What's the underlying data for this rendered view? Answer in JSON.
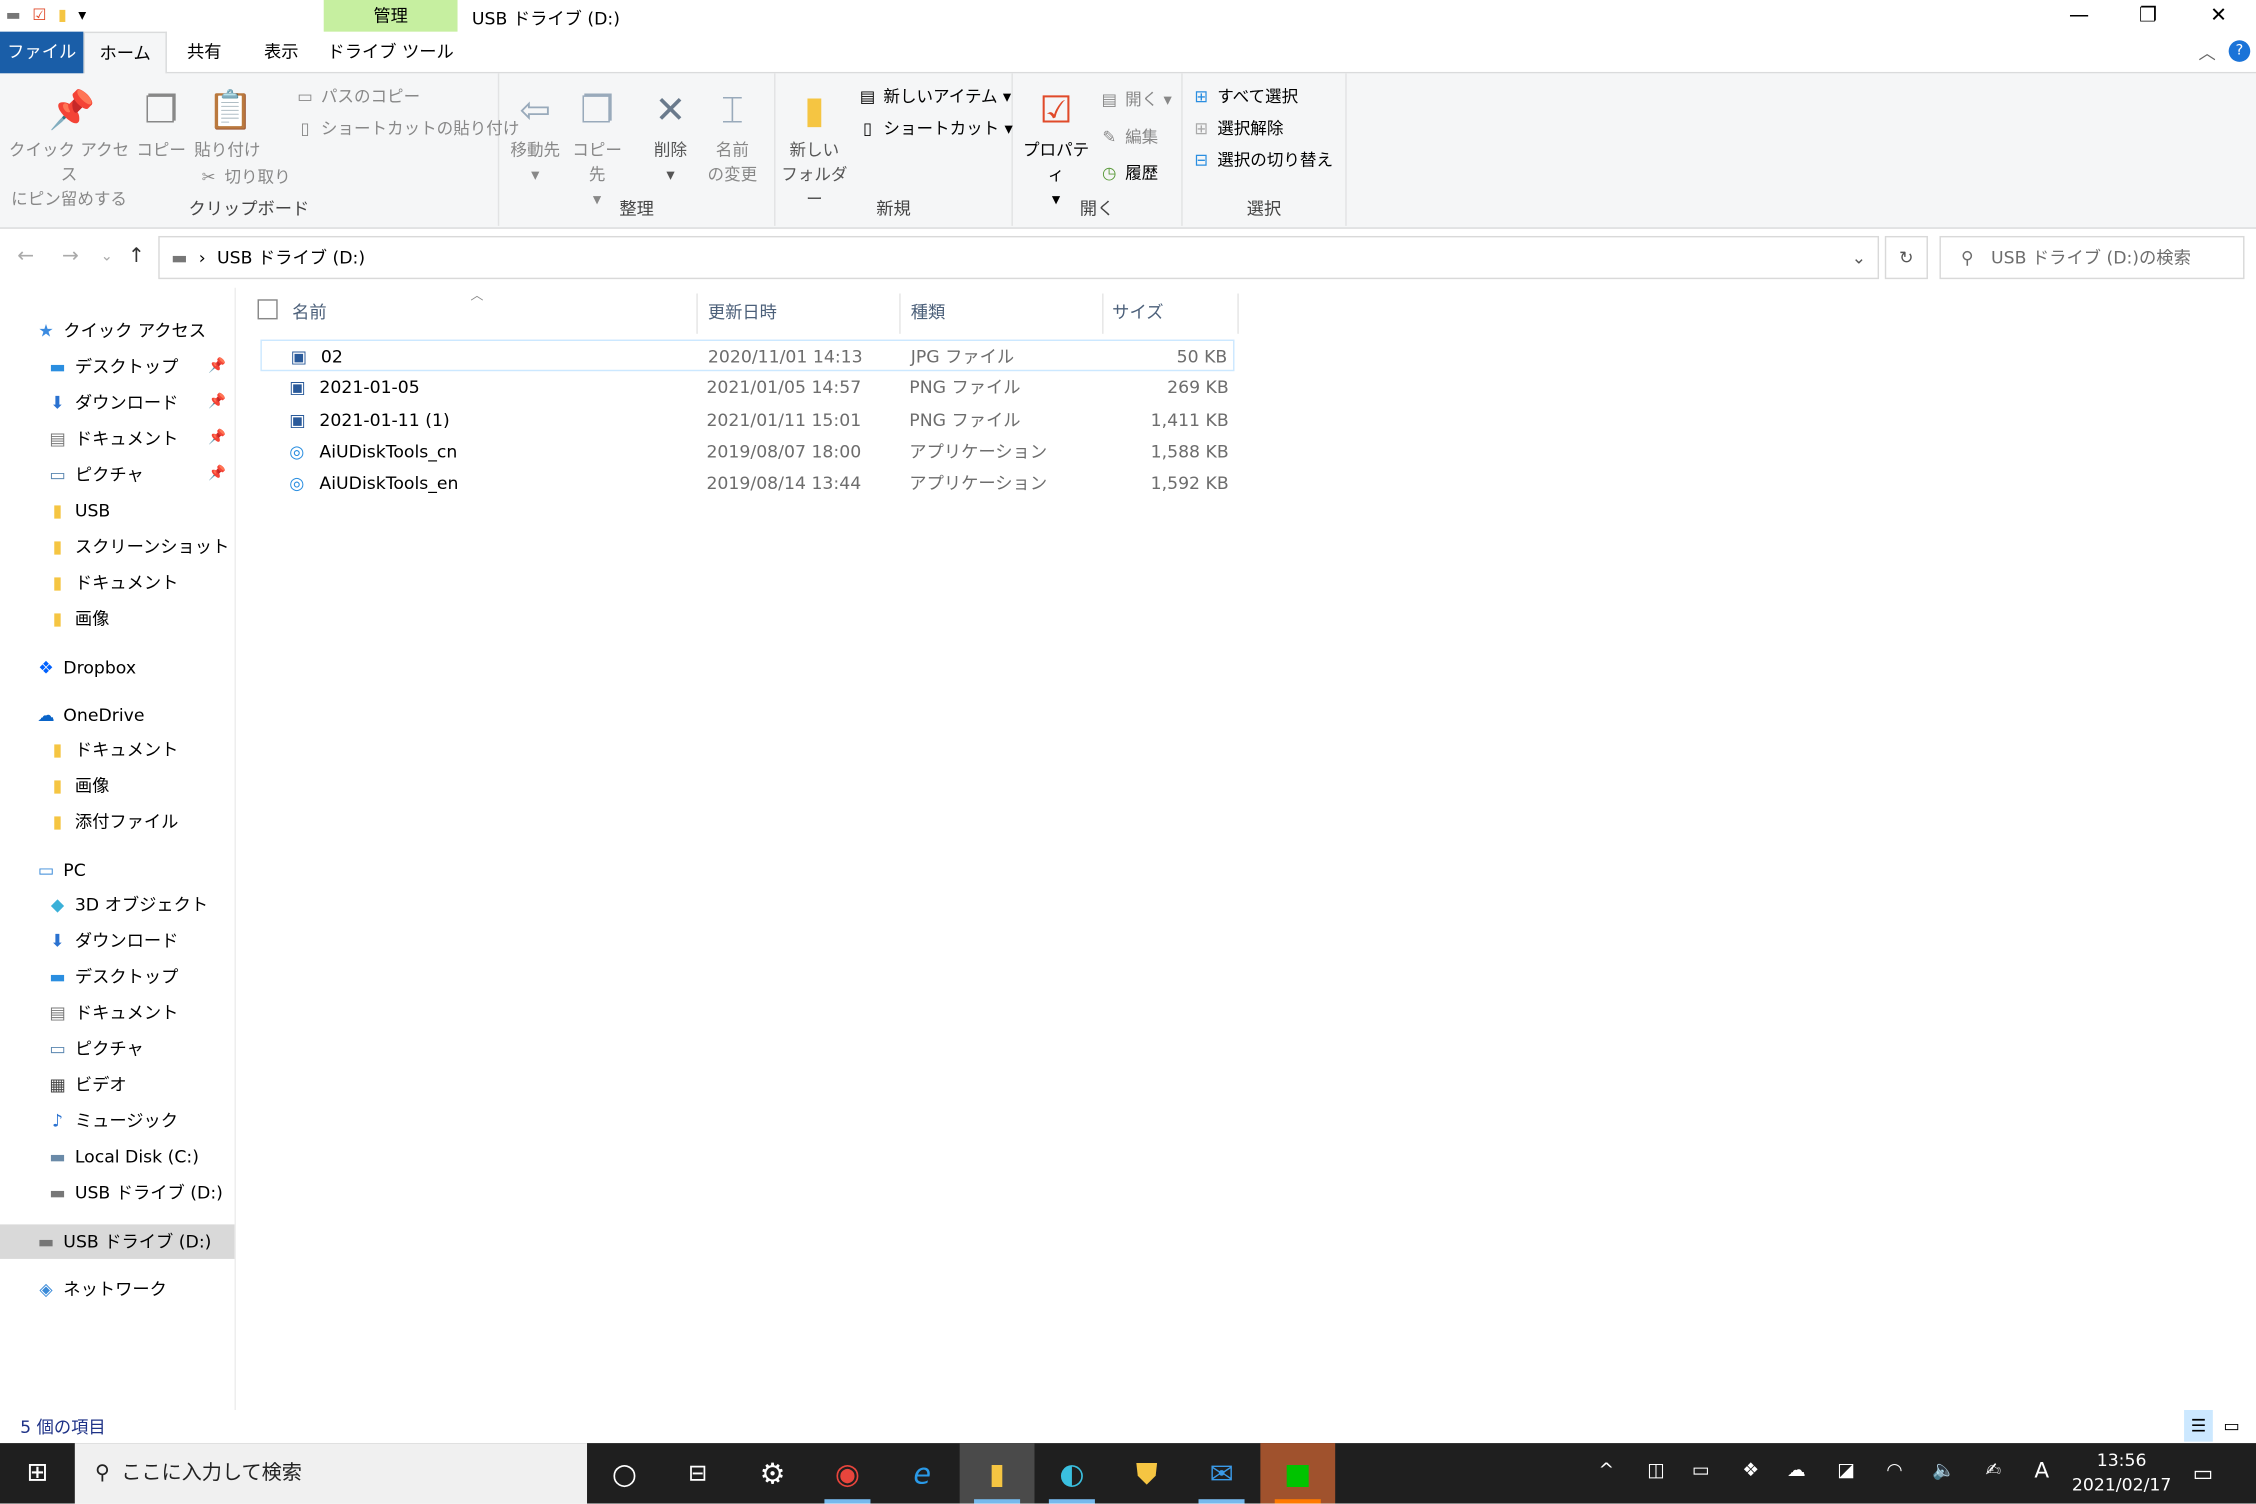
{
  "window": {
    "title": "USB ドライブ (D:)",
    "context_tab": "管理",
    "minimize_icon": "minimize-icon",
    "maximize_icon": "restore-icon",
    "close_icon": "close-icon"
  },
  "tabs": [
    {
      "label": "ファイル"
    },
    {
      "label": "ホーム"
    },
    {
      "label": "共有"
    },
    {
      "label": "表示"
    },
    {
      "label": "ドライブ ツール"
    }
  ],
  "ribbon": {
    "clipboard": {
      "label": "クリップボード",
      "pin": "クイック アクセス",
      "pin2": "にピン留めする",
      "copy": "コピー",
      "paste": "貼り付け",
      "copy_path": "パスのコピー",
      "paste_shortcut": "ショートカットの貼り付け",
      "cut": "切り取り"
    },
    "organize": {
      "label": "整理",
      "move": "移動先",
      "copy_to": "コピー先",
      "delete": "削除",
      "rename": "名前",
      "rename2": "の変更"
    },
    "new": {
      "label": "新規",
      "new_folder": "新しい",
      "new_folder2": "フォルダー",
      "new_item": "新しいアイテム",
      "shortcut": "ショートカット"
    },
    "open": {
      "label": "開く",
      "properties": "プロパティ",
      "open": "開く",
      "edit": "編集",
      "history": "履歴"
    },
    "select": {
      "label": "選択",
      "select_all": "すべて選択",
      "select_none": "選択解除",
      "invert": "選択の切り替え"
    }
  },
  "address": {
    "path": "USB ドライブ (D:)",
    "search_placeholder": "USB ドライブ (D:)の検索"
  },
  "nav": [
    {
      "label": "クイック アクセス",
      "icon": "★",
      "color": "#3c8be0",
      "level": 0
    },
    {
      "label": "デスクトップ",
      "icon": "▬",
      "color": "#2a8ee0",
      "level": 1,
      "pin": true
    },
    {
      "label": "ダウンロード",
      "icon": "⬇",
      "color": "#2a72d0",
      "level": 1,
      "pin": true
    },
    {
      "label": "ドキュメント",
      "icon": "▤",
      "color": "#777",
      "level": 1,
      "pin": true
    },
    {
      "label": "ピクチャ",
      "icon": "▭",
      "color": "#5a86b0",
      "level": 1,
      "pin": true
    },
    {
      "label": "USB",
      "icon": "▮",
      "color": "#f5c542",
      "level": 1
    },
    {
      "label": "スクリーンショット",
      "icon": "▮",
      "color": "#f5c542",
      "level": 1
    },
    {
      "label": "ドキュメント",
      "icon": "▮",
      "color": "#f5c542",
      "level": 1
    },
    {
      "label": "画像",
      "icon": "▮",
      "color": "#f5c542",
      "level": 1
    },
    {
      "label": "Dropbox",
      "icon": "❖",
      "color": "#0061fe",
      "level": 0,
      "gap": true
    },
    {
      "label": "OneDrive",
      "icon": "☁",
      "color": "#0a64c8",
      "level": 0,
      "gap": true
    },
    {
      "label": "ドキュメント",
      "icon": "▮",
      "color": "#f5c542",
      "level": 1
    },
    {
      "label": "画像",
      "icon": "▮",
      "color": "#f5c542",
      "level": 1
    },
    {
      "label": "添付ファイル",
      "icon": "▮",
      "color": "#f5c542",
      "level": 1
    },
    {
      "label": "PC",
      "icon": "▭",
      "color": "#3a8ad8",
      "level": 0,
      "gap": true
    },
    {
      "label": "3D オブジェクト",
      "icon": "◆",
      "color": "#3ab0d8",
      "level": 1
    },
    {
      "label": "ダウンロード",
      "icon": "⬇",
      "color": "#2a72d0",
      "level": 1
    },
    {
      "label": "デスクトップ",
      "icon": "▬",
      "color": "#2a8ee0",
      "level": 1
    },
    {
      "label": "ドキュメント",
      "icon": "▤",
      "color": "#777",
      "level": 1
    },
    {
      "label": "ピクチャ",
      "icon": "▭",
      "color": "#5a86b0",
      "level": 1
    },
    {
      "label": "ビデオ",
      "icon": "▦",
      "color": "#444",
      "level": 1
    },
    {
      "label": "ミュージック",
      "icon": "♪",
      "color": "#2a72d0",
      "level": 1
    },
    {
      "label": "Local Disk (C:)",
      "icon": "▬",
      "color": "#6a8aa8",
      "level": 1
    },
    {
      "label": "USB ドライブ (D:)",
      "icon": "▬",
      "color": "#777",
      "level": 1
    },
    {
      "label": "USB ドライブ (D:)",
      "icon": "▬",
      "color": "#777",
      "level": 0,
      "gap": true,
      "selected": true
    },
    {
      "label": "ネットワーク",
      "icon": "◈",
      "color": "#3a8ad8",
      "level": 0,
      "gap": true
    }
  ],
  "columns": {
    "name": "名前",
    "date": "更新日時",
    "type": "種類",
    "size": "サイズ"
  },
  "files": [
    {
      "name": "02",
      "date": "2020/11/01 14:13",
      "type": "JPG ファイル",
      "size": "50 KB",
      "icon": "image-file-icon",
      "selected": true
    },
    {
      "name": "2021-01-05",
      "date": "2021/01/05 14:57",
      "type": "PNG ファイル",
      "size": "269 KB",
      "icon": "image-file-icon"
    },
    {
      "name": "2021-01-11 (1)",
      "date": "2021/01/11 15:01",
      "type": "PNG ファイル",
      "size": "1,411 KB",
      "icon": "image-file-icon"
    },
    {
      "name": "AiUDiskTools_cn",
      "date": "2019/08/07 18:00",
      "type": "アプリケーション",
      "size": "1,588 KB",
      "icon": "fingerprint-app-icon"
    },
    {
      "name": "AiUDiskTools_en",
      "date": "2019/08/14 13:44",
      "type": "アプリケーション",
      "size": "1,592 KB",
      "icon": "fingerprint-app-icon"
    }
  ],
  "status": {
    "count": "5 個の項目"
  },
  "taskbar": {
    "search_placeholder": "ここに入力して検索",
    "time": "13:56",
    "date": "2021/02/17",
    "ime": "A"
  },
  "colors": {
    "file_tab": "#1a5ea8",
    "context_tab": "#c6efa0",
    "taskbar": "#1f1f1f",
    "selection": "#cce8ff"
  }
}
